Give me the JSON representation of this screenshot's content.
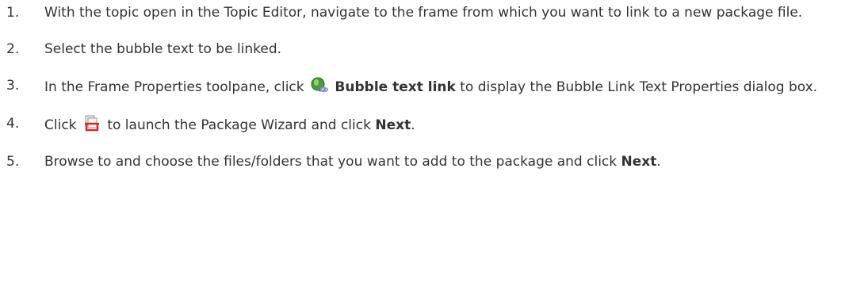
{
  "steps": [
    {
      "num": "1.",
      "text": "With the topic open in the Topic Editor, navigate to the frame from which you want to link to a new package file."
    },
    {
      "num": "2.",
      "text": "Select the bubble text to be linked."
    },
    {
      "num": "3.",
      "pre": "In the Frame Properties toolpane, click",
      "icon": "bubble-text-link-icon",
      "bold": "Bubble text link",
      "post": "to display the Bubble Link Text Properties dialog box."
    },
    {
      "num": "4.",
      "pre": "Click",
      "icon": "package-wizard-icon",
      "mid": "to launch the Package Wizard and click",
      "bold": "Next",
      "post": "."
    },
    {
      "num": "5.",
      "pre": "Browse to and choose the files/folders that you want to add to the package and click",
      "bold": "Next",
      "post": "."
    }
  ]
}
